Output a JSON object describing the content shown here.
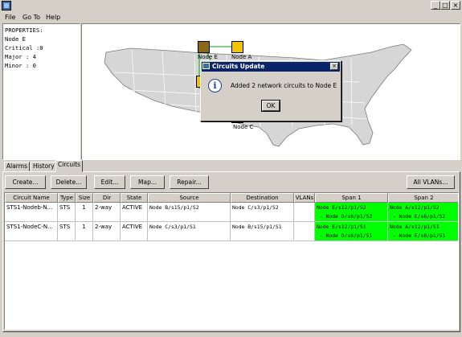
{
  "window": {
    "min_glyph": "_",
    "max_glyph": "□",
    "close_glyph": "×"
  },
  "menu": {
    "items": [
      "File",
      "Go To",
      "Help"
    ]
  },
  "properties": {
    "header": "PROPERTIES:",
    "lines": [
      "Node E",
      "Critical :0",
      "Major : 4",
      "Minor : 0"
    ]
  },
  "map": {
    "nodes": [
      {
        "label": "Node E",
        "color": "#8b6914"
      },
      {
        "label": "Node A",
        "color": "#f2c400"
      },
      {
        "label": "",
        "color": "#f2c400"
      },
      {
        "label": "Node C",
        "color": "#f2c400"
      }
    ]
  },
  "dialog": {
    "title": "Circuits Update",
    "close_glyph": "×",
    "icon_glyph": "i",
    "message": "Added 2 network circuits to Node E",
    "ok_label": "OK"
  },
  "tabs": {
    "items": [
      "Alarms",
      "History",
      "Circuits"
    ],
    "active": "Circuits"
  },
  "toolbar": {
    "create": "Create...",
    "delete": "Delete...",
    "edit": "Edit...",
    "map": "Map...",
    "repair": "Repair...",
    "all_vlans": "All VLANs..."
  },
  "table": {
    "columns": [
      "Circuit Name",
      "Type",
      "Size",
      "Dir",
      "State",
      "Source",
      "Destination",
      "VLANs",
      "Span 1",
      "Span 2"
    ],
    "rows": [
      {
        "name": "STS1-Nodeb-N...",
        "type": "STS",
        "size": "1",
        "dir": "2-way",
        "state": "ACTIVE",
        "source": "Node B/s15/p1/S2",
        "destination": "Node C/s3/p1/S2",
        "vlans": "",
        "span1_a": "Node E/s12/p1/S2",
        "span1_b": " - Node D/s6/p1/S2",
        "span2_a": "Node A/s12/p1/S2",
        "span2_b": " - Node E/s6/p1/S2"
      },
      {
        "name": "STS1-NodeC-N...",
        "type": "STS",
        "size": "1",
        "dir": "2-way",
        "state": "ACTIVE",
        "source": "Node C/s3/p1/S1",
        "destination": "Node B/s15/p1/S1",
        "vlans": "",
        "span1_a": "Node E/s12/p1/S1",
        "span1_b": " - Node D/s6/p1/S1",
        "span2_a": "Node A/s12/p1/S1",
        "span2_b": " - Node E/s6/p1/S1"
      }
    ]
  },
  "colors": {
    "span_highlight": "#00ff00",
    "title_active": "#0a246a"
  }
}
